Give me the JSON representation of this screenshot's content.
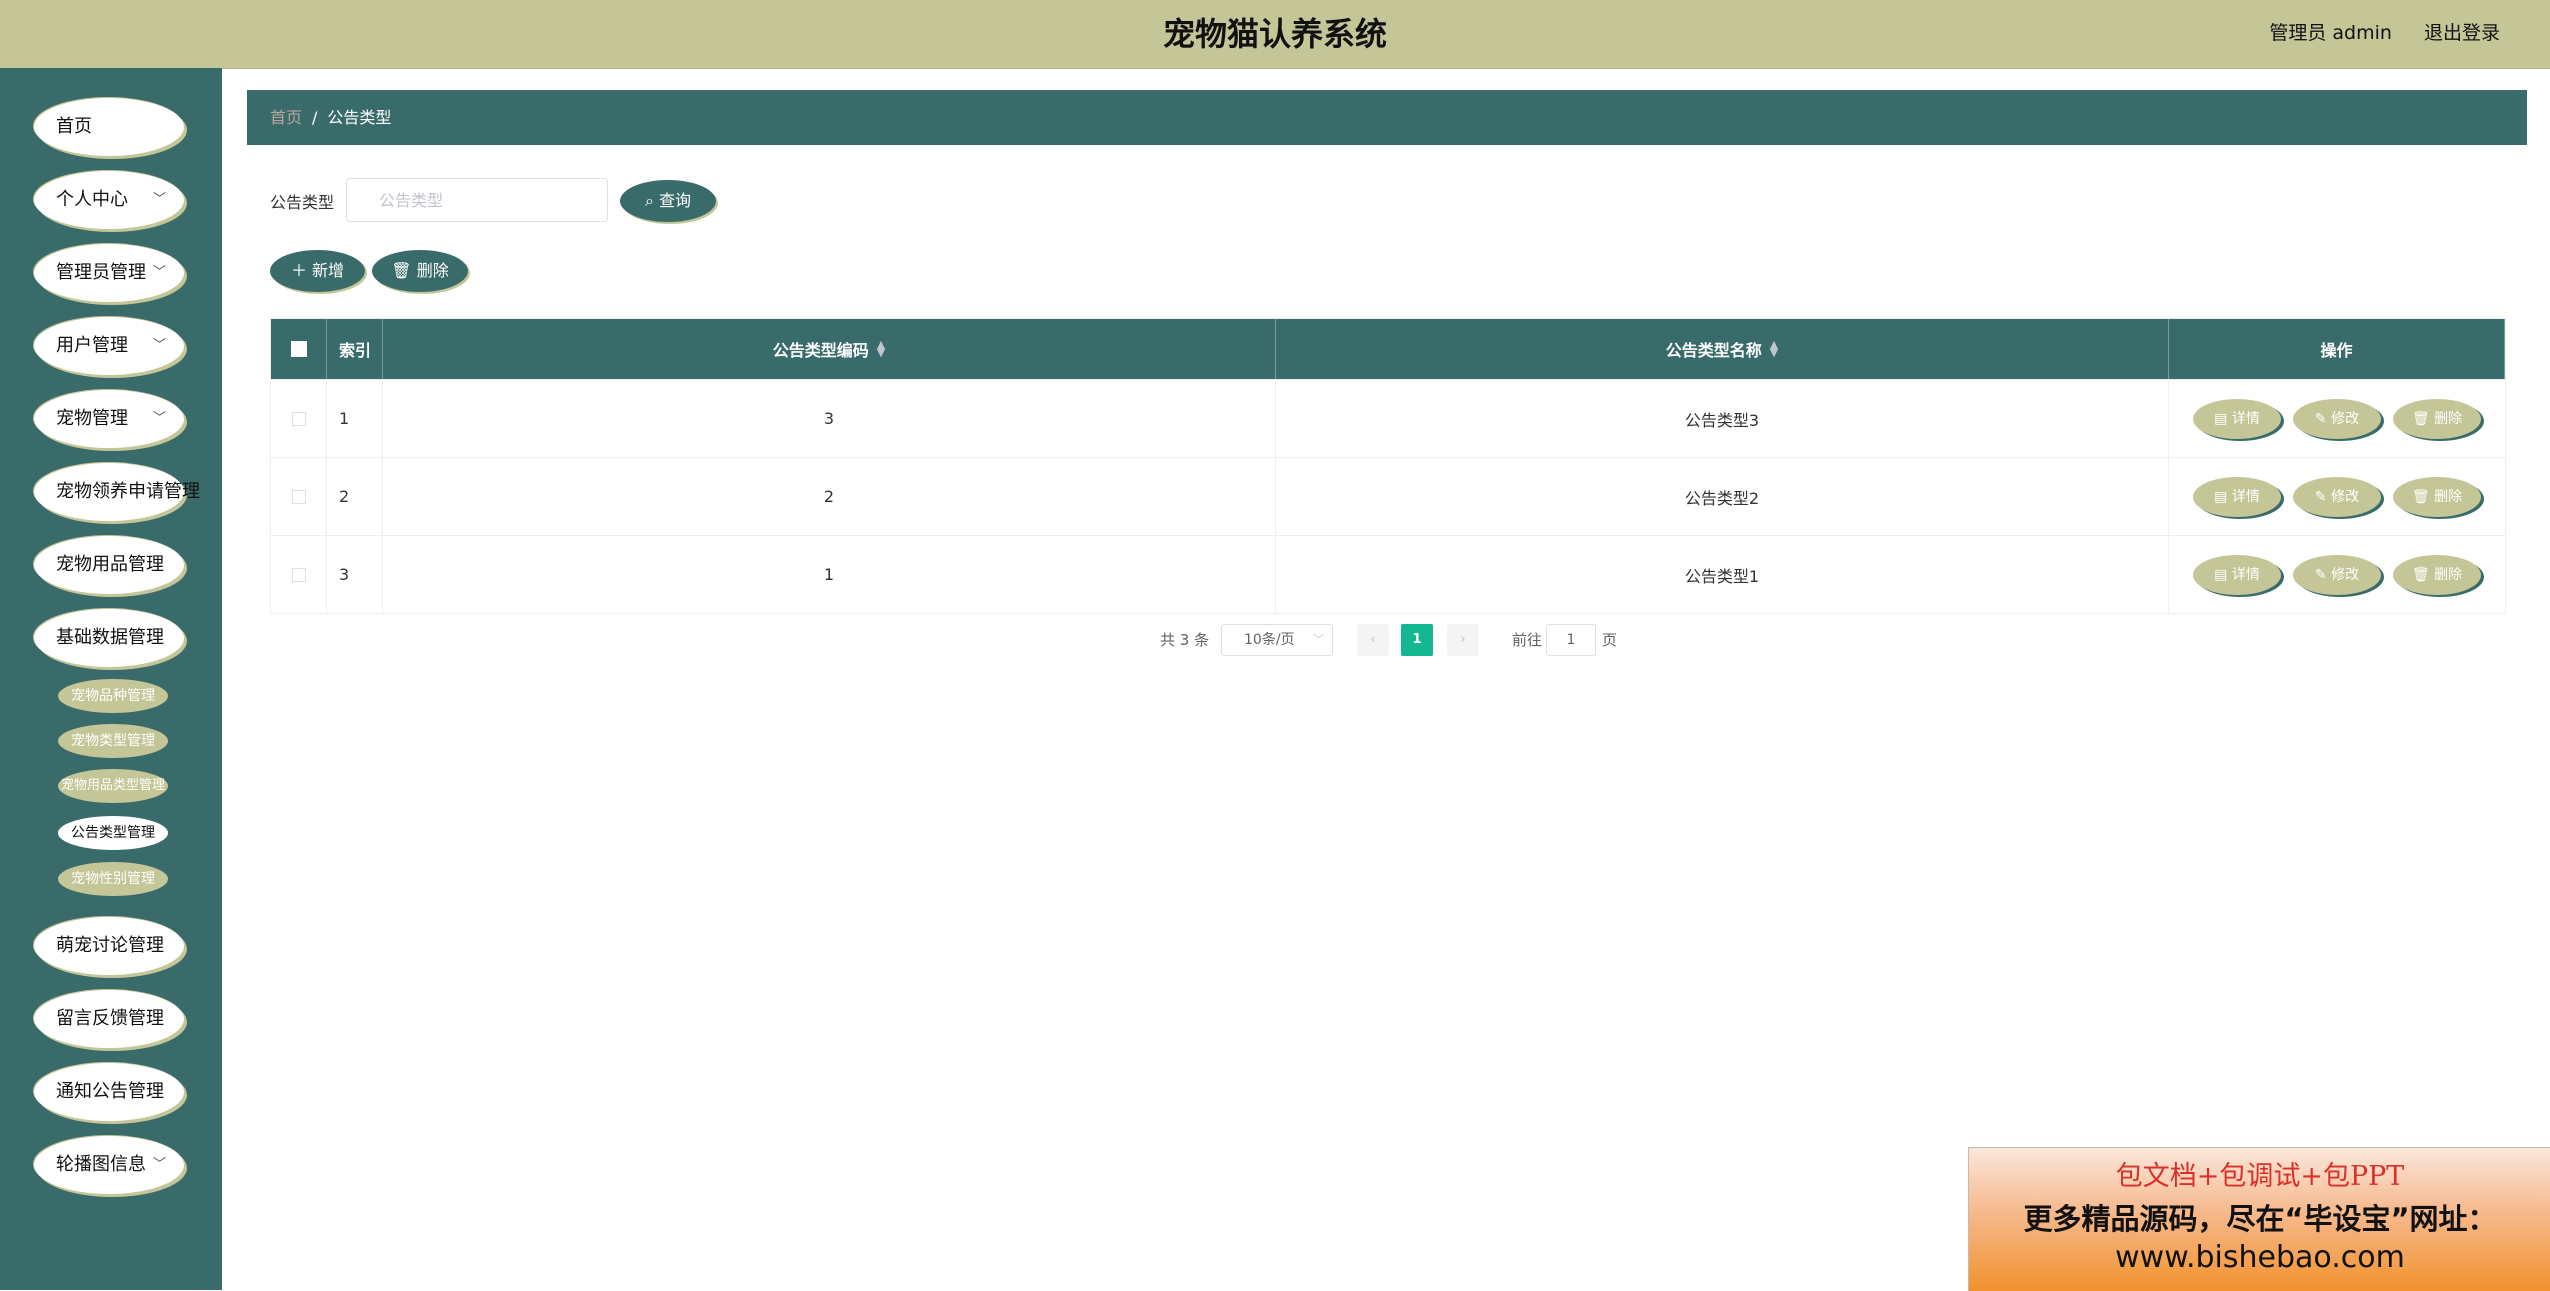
{
  "header": {
    "title": "宠物猫认养系统",
    "user_label": "管理员 admin",
    "logout_label": "退出登录"
  },
  "sidebar": {
    "items": [
      {
        "label": "首页",
        "has_children": false
      },
      {
        "label": "个人中心",
        "has_children": true
      },
      {
        "label": "管理员管理",
        "has_children": true
      },
      {
        "label": "用户管理",
        "has_children": true
      },
      {
        "label": "宠物管理",
        "has_children": true
      },
      {
        "label": "宠物领养申请管理",
        "has_children": false
      },
      {
        "label": "宠物用品管理",
        "has_children": false
      },
      {
        "label": "基础数据管理",
        "has_children": false
      },
      {
        "label": "萌宠讨论管理",
        "has_children": false
      },
      {
        "label": "留言反馈管理",
        "has_children": false
      },
      {
        "label": "通知公告管理",
        "has_children": false
      },
      {
        "label": "轮播图信息",
        "has_children": true
      }
    ],
    "subitems": [
      {
        "label": "宠物品种管理",
        "active": false
      },
      {
        "label": "宠物类型管理",
        "active": false
      },
      {
        "label": "宠物用品类型管理",
        "active": false
      },
      {
        "label": "公告类型管理",
        "active": true
      },
      {
        "label": "宠物性别管理",
        "active": false
      }
    ]
  },
  "breadcrumb": {
    "home": "首页",
    "separator": "/",
    "current": "公告类型"
  },
  "search": {
    "label": "公告类型",
    "placeholder": "公告类型",
    "value": "",
    "button_label": "查询"
  },
  "toolbar": {
    "add_label": "新增",
    "delete_label": "删除"
  },
  "table": {
    "columns": {
      "index": "索引",
      "code": "公告类型编码",
      "name": "公告类型名称",
      "actions": "操作"
    },
    "rows": [
      {
        "index": "1",
        "code": "3",
        "name": "公告类型3"
      },
      {
        "index": "2",
        "code": "2",
        "name": "公告类型2"
      },
      {
        "index": "3",
        "code": "1",
        "name": "公告类型1"
      }
    ],
    "row_actions": {
      "detail": "详情",
      "edit": "修改",
      "delete": "删除"
    }
  },
  "pagination": {
    "total_text": "共 3 条",
    "page_size": "10条/页",
    "current_page": "1",
    "goto_label": "前往",
    "goto_value": "1",
    "page_suffix": "页"
  },
  "ad": {
    "line1": "包文档+包调试+包PPT",
    "line2": "更多精品源码，尽在“毕设宝”网址：",
    "line3": "www.bishebao.com"
  },
  "colors": {
    "primary": "#3a6b6b",
    "accent": "#c5c697",
    "pager_active": "#13b890"
  }
}
